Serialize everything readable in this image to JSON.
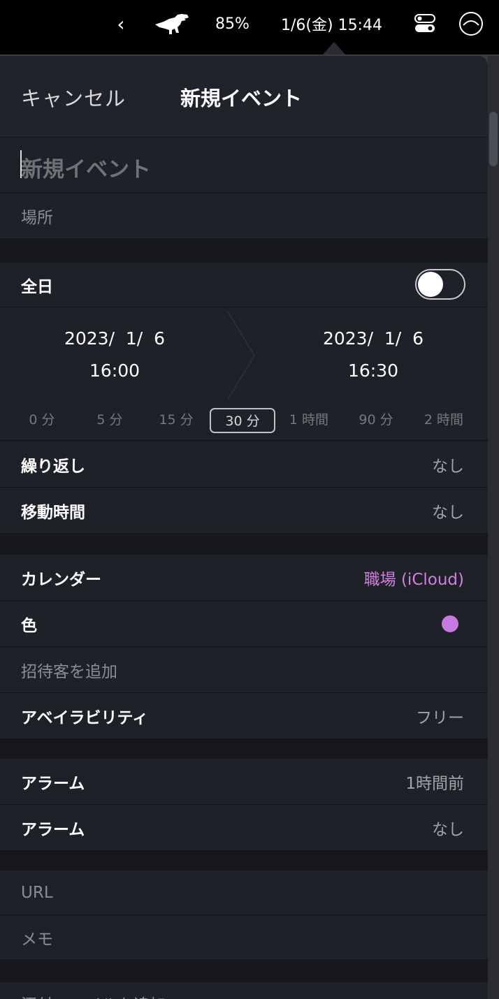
{
  "menubar": {
    "chevron": "‹",
    "battery": "85%",
    "clock": "1/6(金) 15:44"
  },
  "header": {
    "cancel": "キャンセル",
    "title": "新規イベント"
  },
  "event": {
    "title_placeholder": "新規イベント",
    "location_placeholder": "場所"
  },
  "all_day": {
    "label": "全日",
    "enabled": false
  },
  "start": {
    "date": "2023/  1/  6",
    "time": "16:00"
  },
  "end": {
    "date": "2023/  1/  6",
    "time": "16:30"
  },
  "durations": {
    "options": [
      "0 分",
      "5 分",
      "15 分",
      "30 分",
      "1 時間",
      "90 分",
      "2 時間"
    ],
    "selected": "30 分"
  },
  "repeat": {
    "label": "繰り返し",
    "value": "なし"
  },
  "travel_time": {
    "label": "移動時間",
    "value": "なし"
  },
  "calendar": {
    "label": "カレンダー",
    "value": "職場 (iCloud)"
  },
  "color": {
    "label": "色",
    "value": "#c77be0"
  },
  "invitees": {
    "placeholder": "招待客を追加"
  },
  "availability": {
    "label": "アベイラビリティ",
    "value": "フリー"
  },
  "alarms": [
    {
      "label": "アラーム",
      "value": "1時間前"
    },
    {
      "label": "アラーム",
      "value": "なし"
    }
  ],
  "url": {
    "placeholder": "URL"
  },
  "memo": {
    "placeholder": "メモ"
  },
  "attachment": {
    "label": "添付ファイルを追加"
  },
  "colors": {
    "accent_calendar": "#d27fe0",
    "event_color": "#c77be0",
    "background": "#1e2127"
  }
}
